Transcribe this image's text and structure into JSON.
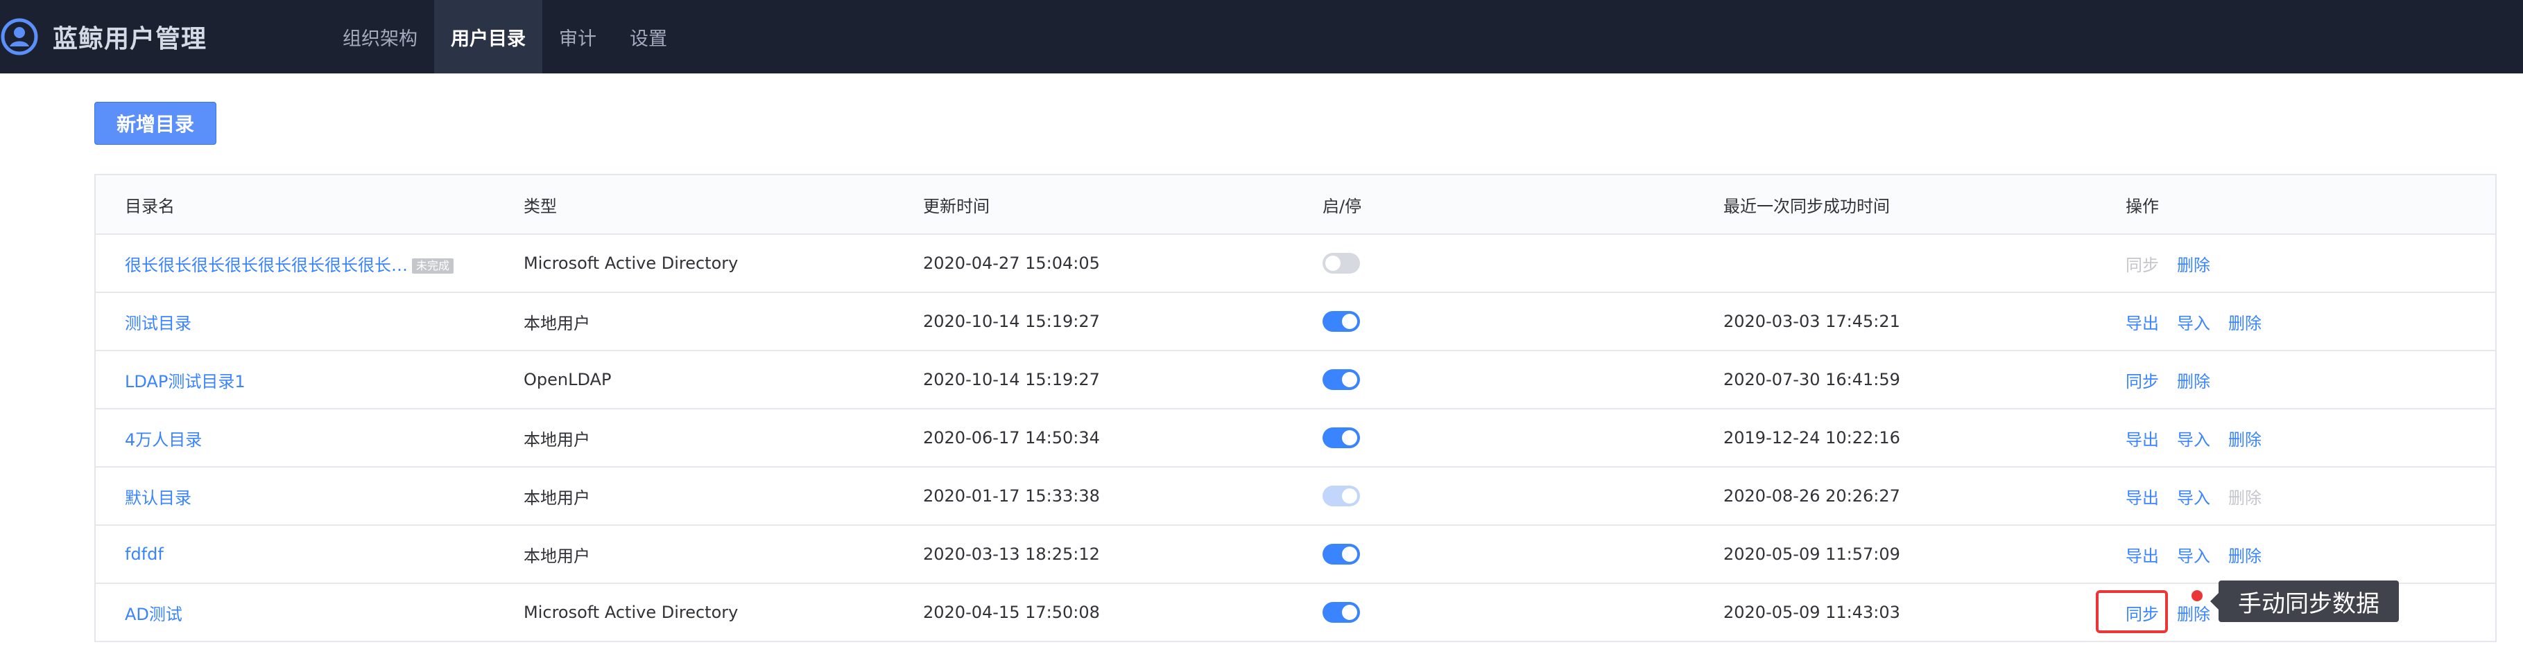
{
  "app": {
    "title": "蓝鲸用户管理",
    "logo_icon": "user-circle-icon"
  },
  "nav": [
    {
      "label": "组织架构",
      "active": false
    },
    {
      "label": "用户目录",
      "active": true
    },
    {
      "label": "审计",
      "active": false
    },
    {
      "label": "设置",
      "active": false
    }
  ],
  "toolbar": {
    "add_label": "新增目录"
  },
  "table": {
    "headers": [
      "目录名",
      "类型",
      "更新时间",
      "启/停",
      "最近一次同步成功时间",
      "操作"
    ],
    "rows": [
      {
        "name": "很长很长很长很长很长很长很长很长…",
        "badge": "未完成",
        "type": "Microsoft Active Directory",
        "updated": "2020-04-27 15:04:05",
        "enabled": "off",
        "last_sync": "",
        "actions": [
          {
            "label": "同步",
            "disabled": true
          },
          {
            "label": "删除",
            "disabled": false
          }
        ]
      },
      {
        "name": "测试目录",
        "badge": "",
        "type": "本地用户",
        "updated": "2020-10-14 15:19:27",
        "enabled": "on",
        "last_sync": "2020-03-03 17:45:21",
        "actions": [
          {
            "label": "导出",
            "disabled": false
          },
          {
            "label": "导入",
            "disabled": false
          },
          {
            "label": "删除",
            "disabled": false
          }
        ]
      },
      {
        "name": "LDAP测试目录1",
        "badge": "",
        "type": "OpenLDAP",
        "updated": "2020-10-14 15:19:27",
        "enabled": "on",
        "last_sync": "2020-07-30 16:41:59",
        "actions": [
          {
            "label": "同步",
            "disabled": false
          },
          {
            "label": "删除",
            "disabled": false
          }
        ]
      },
      {
        "name": "4万人目录",
        "badge": "",
        "type": "本地用户",
        "updated": "2020-06-17 14:50:34",
        "enabled": "on",
        "last_sync": "2019-12-24 10:22:16",
        "actions": [
          {
            "label": "导出",
            "disabled": false
          },
          {
            "label": "导入",
            "disabled": false
          },
          {
            "label": "删除",
            "disabled": false
          }
        ]
      },
      {
        "name": "默认目录",
        "badge": "",
        "type": "本地用户",
        "updated": "2020-01-17 15:33:38",
        "enabled": "on-disabled",
        "last_sync": "2020-08-26 20:26:27",
        "actions": [
          {
            "label": "导出",
            "disabled": false
          },
          {
            "label": "导入",
            "disabled": false
          },
          {
            "label": "删除",
            "disabled": true
          }
        ]
      },
      {
        "name": "fdfdf",
        "badge": "",
        "type": "本地用户",
        "updated": "2020-03-13 18:25:12",
        "enabled": "on",
        "last_sync": "2020-05-09 11:57:09",
        "actions": [
          {
            "label": "导出",
            "disabled": false
          },
          {
            "label": "导入",
            "disabled": false
          },
          {
            "label": "删除",
            "disabled": false
          }
        ]
      },
      {
        "name": "AD测试",
        "badge": "",
        "type": "Microsoft Active Directory",
        "updated": "2020-04-15 17:50:08",
        "enabled": "on",
        "last_sync": "2020-05-09 11:43:03",
        "actions": [
          {
            "label": "同步",
            "disabled": false
          },
          {
            "label": "删除",
            "disabled": false
          }
        ]
      }
    ]
  },
  "tooltip": {
    "text": "手动同步数据"
  },
  "colors": {
    "topbar": "#1b2130",
    "primary": "#5b8ff9",
    "link": "#3a84ff",
    "highlight": "#ea3636"
  }
}
